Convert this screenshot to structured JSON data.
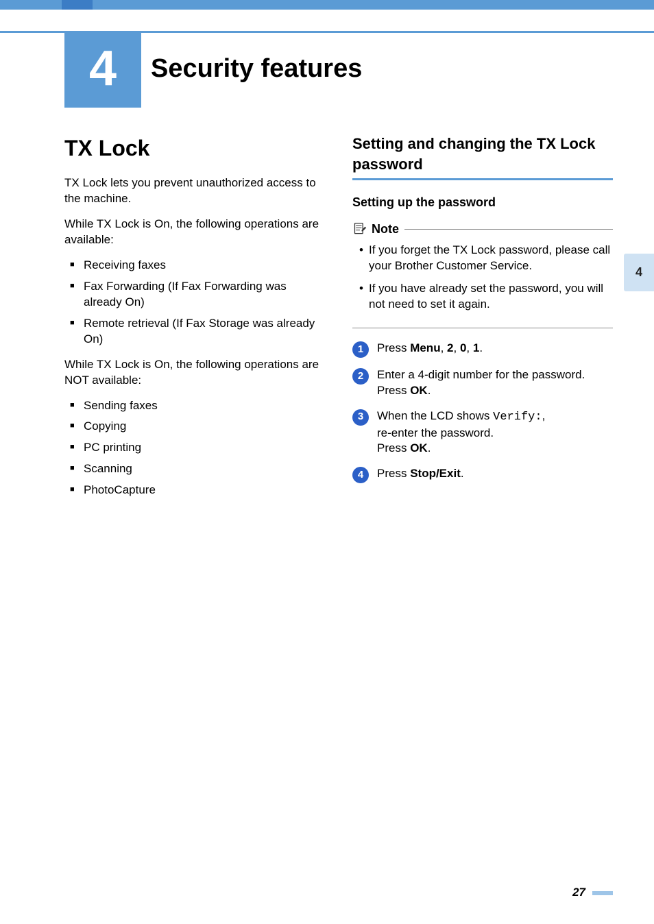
{
  "chapter": {
    "number": "4",
    "title": "Security features"
  },
  "side_tab": "4",
  "page_number": "27",
  "left": {
    "heading": "TX Lock",
    "intro": "TX Lock lets you prevent unauthorized access to the machine.",
    "available_intro": "While TX Lock is On, the following operations are available:",
    "available": [
      "Receiving faxes",
      "Fax Forwarding (If Fax Forwarding was already On)",
      "Remote retrieval (If Fax Storage was already On)"
    ],
    "not_available_intro": "While TX Lock is On, the following operations are NOT available:",
    "not_available": [
      "Sending faxes",
      "Copying",
      "PC printing",
      "Scanning",
      "PhotoCapture"
    ]
  },
  "right": {
    "heading": "Setting and changing the TX Lock password",
    "sub": "Setting up the password",
    "note_label": "Note",
    "notes": [
      "If you forget the TX Lock password, please call your Brother Customer Service.",
      "If you have already set the password, you will not need to set it again."
    ],
    "steps": {
      "s1": {
        "pre": "Press ",
        "b1": "Menu",
        "mid1": ", ",
        "b2": "2",
        "mid2": ", ",
        "b3": "0",
        "mid3": ", ",
        "b4": "1",
        "post": "."
      },
      "s2": {
        "line1": "Enter a 4-digit number for the password.",
        "line2_pre": "Press ",
        "line2_b": "OK",
        "line2_post": "."
      },
      "s3": {
        "pre": "When the LCD shows ",
        "code": "Verify:",
        "post": ",",
        "line2": "re-enter the password.",
        "line3_pre": "Press ",
        "line3_b": "OK",
        "line3_post": "."
      },
      "s4": {
        "pre": "Press ",
        "b": "Stop/Exit",
        "post": "."
      }
    }
  }
}
